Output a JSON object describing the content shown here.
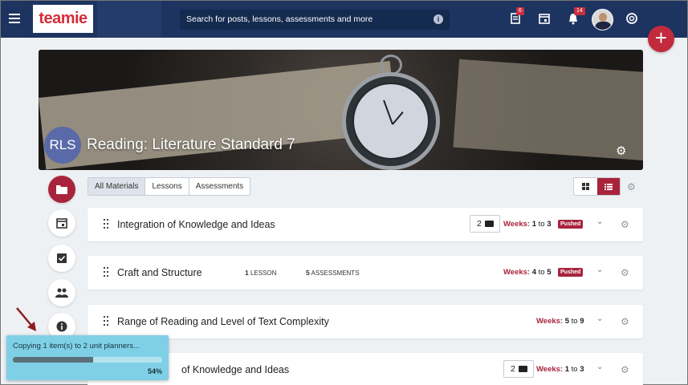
{
  "topbar": {
    "logo_text": "teamie",
    "search_placeholder": "Search for posts, lessons, assessments and more",
    "notifications_badge": "6",
    "alerts_badge": "14"
  },
  "course": {
    "avatar_text": "RLS",
    "title": "Reading: Literature Standard 7"
  },
  "filters": {
    "all": "All Materials",
    "lessons": "Lessons",
    "assessments": "Assessments"
  },
  "units": [
    {
      "title": "Integration of Knowledge and Ideas",
      "comments": "2",
      "weeks_label": "Weeks:",
      "from": "1",
      "to_word": "to",
      "to": "3",
      "status": "Pushed"
    },
    {
      "title": "Craft and Structure",
      "lesson_count": "1",
      "lesson_label": "LESSON",
      "assess_count": "5",
      "assess_label": "ASSESSMENTS",
      "weeks_label": "Weeks:",
      "from": "4",
      "to_word": "to",
      "to": "5",
      "status": "Pushed"
    },
    {
      "title": "Range of Reading and Level of Text Complexity",
      "weeks_label": "Weeks:",
      "from": "5",
      "to_word": "to",
      "to": "9"
    },
    {
      "title": "of Knowledge and Ideas",
      "comments": "2",
      "weeks_label": "Weeks:",
      "from": "1",
      "to_word": "to",
      "to": "3"
    }
  ],
  "toast": {
    "message": "Copying 1 item(s) to 2 unit planners...",
    "percent_label": "54%",
    "progress": 0.54
  },
  "colors": {
    "topbar": "#1d3461",
    "accent": "#a8243c",
    "fab": "#c22a3e",
    "toast": "#7fd0e6"
  }
}
